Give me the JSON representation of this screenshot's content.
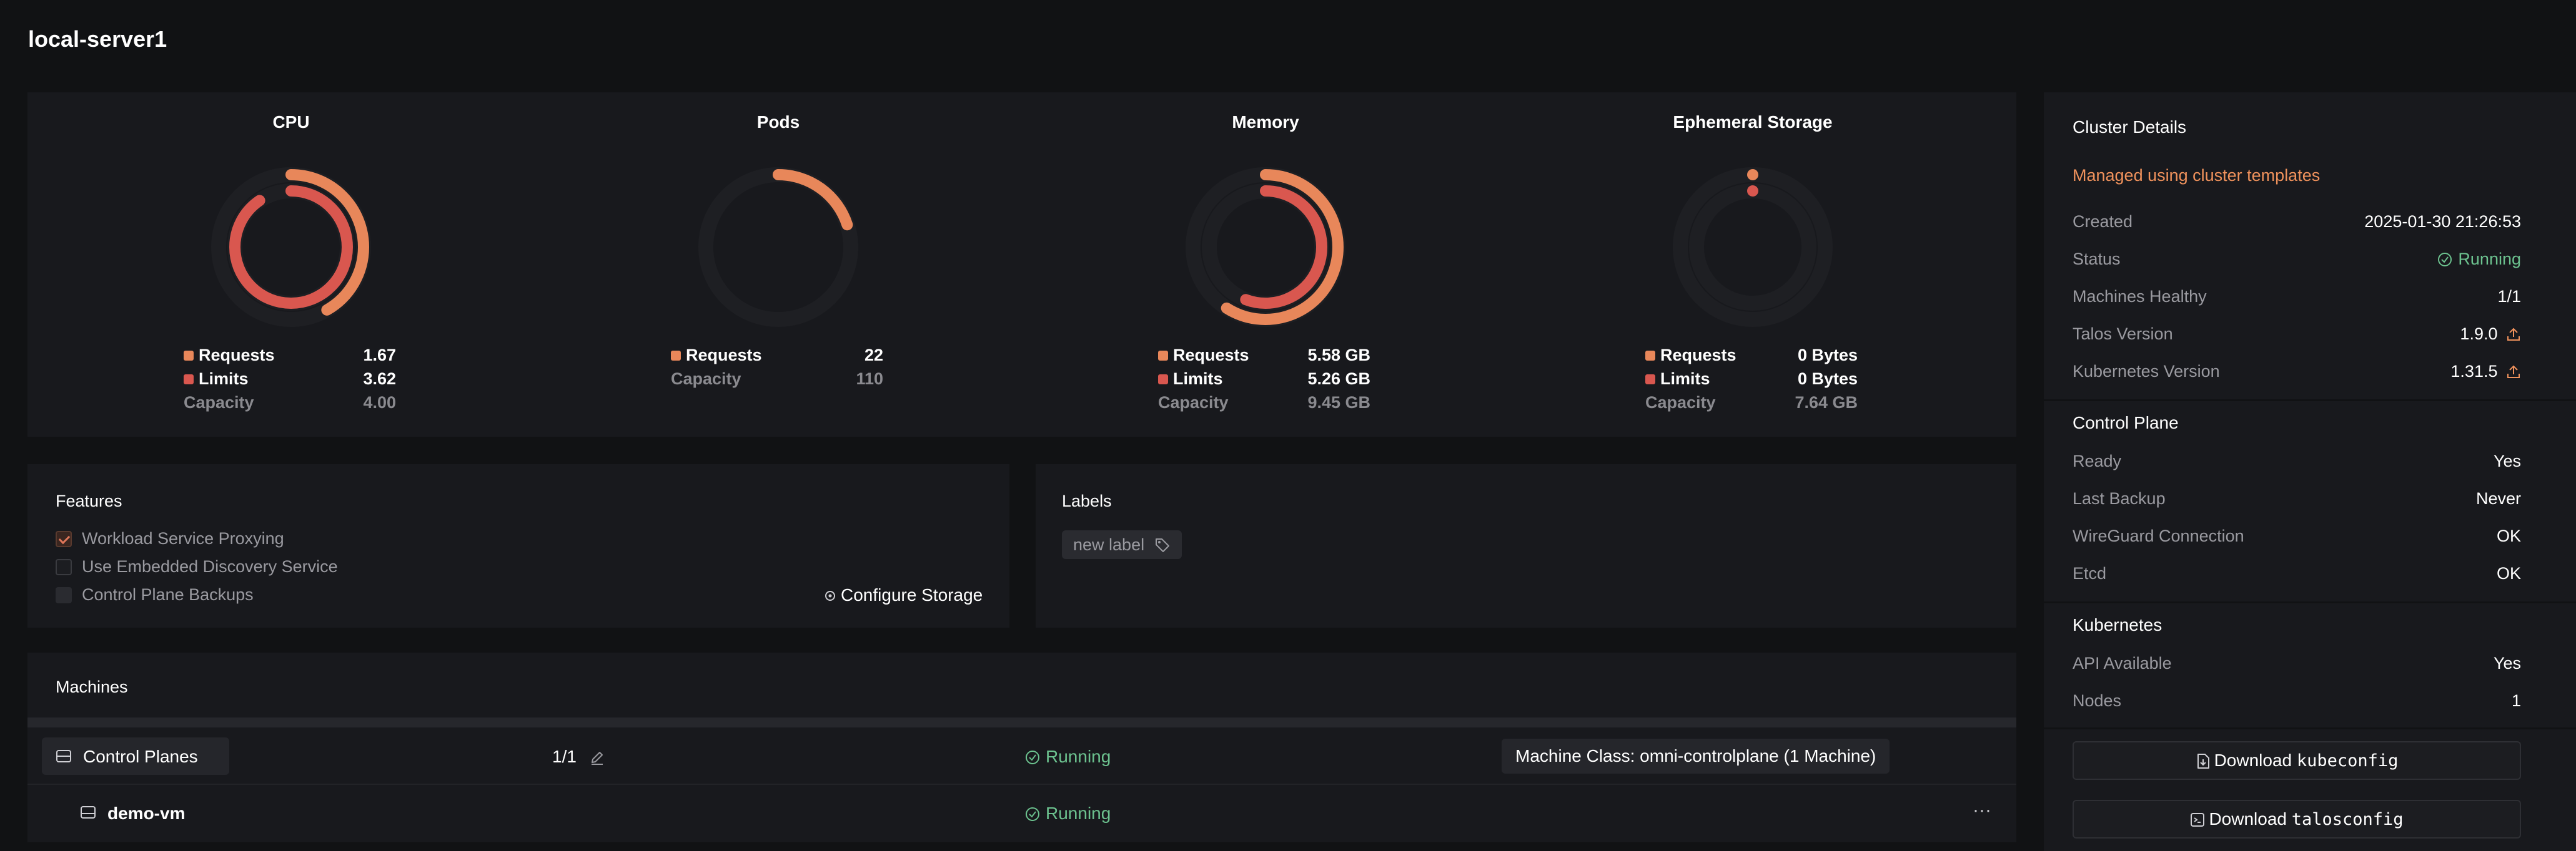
{
  "page": {
    "title": "local-server1"
  },
  "colors": {
    "requests": "#e8875a",
    "limits": "#d9574f",
    "track": "#1e1f23",
    "running": "#6cc28f",
    "accent": "#f0925c"
  },
  "gauges": [
    {
      "title": "CPU",
      "requests": {
        "label": "Requests",
        "value": "1.67",
        "fraction": 0.4175
      },
      "limits": {
        "label": "Limits",
        "value": "3.62",
        "fraction": 0.905
      },
      "capacity": {
        "label": "Capacity",
        "value": "4.00"
      }
    },
    {
      "title": "Pods",
      "requests": {
        "label": "Requests",
        "value": "22",
        "fraction": 0.2
      },
      "capacity": {
        "label": "Capacity",
        "value": "110"
      }
    },
    {
      "title": "Memory",
      "requests": {
        "label": "Requests",
        "value": "5.58 GB",
        "fraction": 0.59
      },
      "limits": {
        "label": "Limits",
        "value": "5.26 GB",
        "fraction": 0.557
      },
      "capacity": {
        "label": "Capacity",
        "value": "9.45 GB"
      }
    },
    {
      "title": "Ephemeral Storage",
      "requests": {
        "label": "Requests",
        "value": "0 Bytes",
        "fraction": 0
      },
      "limits": {
        "label": "Limits",
        "value": "0 Bytes",
        "fraction": 0
      },
      "capacity": {
        "label": "Capacity",
        "value": "7.64 GB"
      }
    }
  ],
  "features": {
    "title": "Features",
    "items": [
      {
        "label": "Workload Service Proxying",
        "checked": true
      },
      {
        "label": "Use Embedded Discovery Service",
        "checked": false
      },
      {
        "label": "Control Plane Backups",
        "checked": false
      }
    ],
    "configure_storage": "Configure Storage"
  },
  "labels": {
    "title": "Labels",
    "new_label": "new label"
  },
  "machines": {
    "title": "Machines",
    "control_planes": {
      "label": "Control Planes",
      "count": "1/1",
      "status": "Running",
      "machine_class": "Machine Class: omni-controlplane (1 Machine)"
    },
    "vm": {
      "name": "demo-vm",
      "status": "Running",
      "menu": "···"
    }
  },
  "cluster_details": {
    "title": "Cluster Details",
    "managed": "Managed using cluster templates",
    "rows": [
      {
        "k": "Created",
        "v": "2025-01-30 21:26:53"
      },
      {
        "k": "Status",
        "v": "Running"
      },
      {
        "k": "Machines Healthy",
        "v": "1/1"
      },
      {
        "k": "Talos Version",
        "v": "1.9.0"
      },
      {
        "k": "Kubernetes Version",
        "v": "1.31.5"
      }
    ],
    "control_plane": {
      "title": "Control Plane",
      "rows": [
        {
          "k": "Ready",
          "v": "Yes"
        },
        {
          "k": "Last Backup",
          "v": "Never"
        },
        {
          "k": "WireGuard Connection",
          "v": "OK"
        },
        {
          "k": "Etcd",
          "v": "OK"
        }
      ]
    },
    "kubernetes": {
      "title": "Kubernetes",
      "rows": [
        {
          "k": "API Available",
          "v": "Yes"
        },
        {
          "k": "Nodes",
          "v": "1"
        }
      ]
    },
    "download_kubeconfig": {
      "prefix": "Download",
      "file": "kubeconfig"
    },
    "download_talosconfig": {
      "prefix": "Download",
      "file": "talosconfig"
    }
  }
}
